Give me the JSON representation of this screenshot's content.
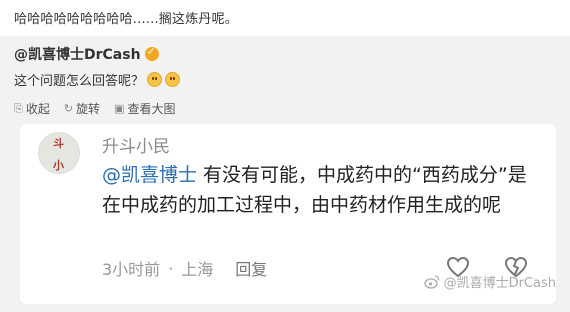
{
  "top_text": "哈哈哈哈哈哈哈哈哈......搁这炼丹呢。",
  "post": {
    "author": "@凯喜博士DrCash",
    "question": "这个问题怎么回答呢？",
    "actions": [
      {
        "icon": "collect-icon",
        "label": "收起"
      },
      {
        "icon": "repost-icon",
        "label": "旋转"
      },
      {
        "icon": "image-icon",
        "label": "查看大图"
      }
    ]
  },
  "reply": {
    "name": "升斗小民",
    "mention": "@凯喜博士",
    "text": " 有没有可能，中成药中的“西药成分”是在中成药的加工过程中，由中药材作用生成的呢",
    "time": "3小时前",
    "location": "上海",
    "reply_label": "回复"
  },
  "watermark": "@凯喜博士DrCash",
  "colors": {
    "accent": "#2a6fb0",
    "verified": "#f5a623"
  }
}
